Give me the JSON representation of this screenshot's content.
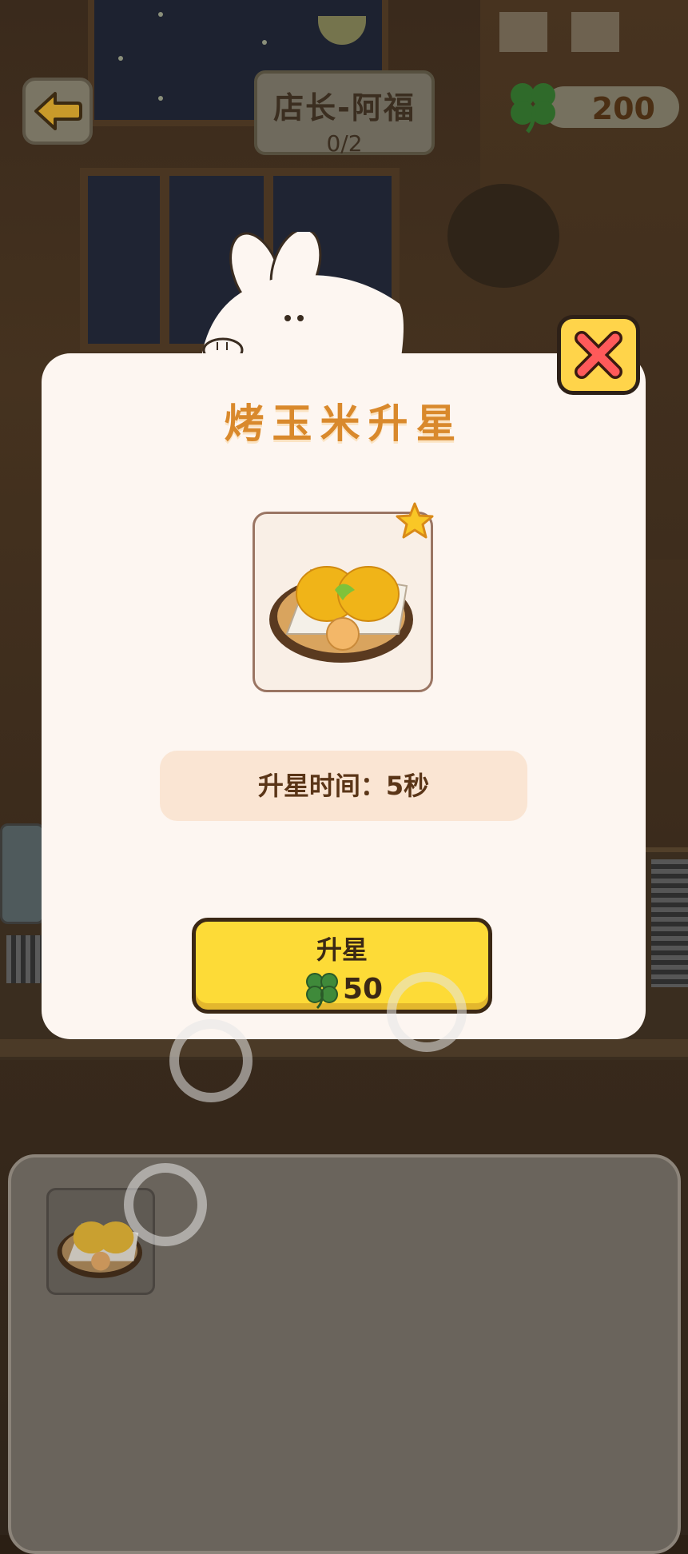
{
  "hud": {
    "shop_title": "店长-阿福",
    "progress": "0/2",
    "clover_count": "200"
  },
  "modal": {
    "title": "烤玉米升星",
    "item_icon": "grilled-corn",
    "star_count": 1,
    "upgrade_time_label": "升星时间：5秒",
    "upgrade_button": {
      "label": "升星",
      "cost": "50",
      "cost_icon": "clover-icon"
    }
  },
  "tray": {
    "slots": [
      {
        "item_icon": "grilled-corn"
      }
    ]
  },
  "colors": {
    "modal_bg": "#fdf6f1",
    "title_orange": "#d9892c",
    "button_yellow": "#fddb37",
    "close_yellow": "#ffd44a",
    "close_red": "#ff5a5a",
    "clover_green": "#3f8a3a"
  }
}
